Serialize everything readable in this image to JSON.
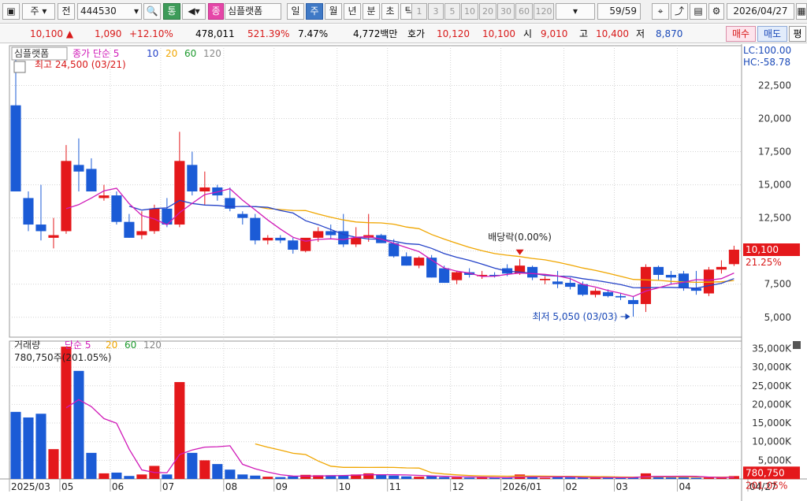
{
  "toolbar": {
    "mode_button": "주",
    "prev_label": "전",
    "stock_code": "444530",
    "tong_label": "통",
    "tag_label": "종",
    "stock_name": "심플랫폼",
    "periods": [
      "일",
      "주",
      "월",
      "년",
      "분",
      "초",
      "틱"
    ],
    "selected_period": "주",
    "intervals": [
      "1",
      "3",
      "5",
      "10",
      "20",
      "30",
      "60",
      "120"
    ],
    "count": "59/59",
    "date": "2026/04/27"
  },
  "quote": {
    "price": "10,100",
    "change": "1,090",
    "change_rate": "+12.10%",
    "volume": "478,011",
    "volume_rate": "521.39%",
    "turnover": "7.47%",
    "amount": "4,772백만",
    "hoga_label": "호가",
    "ask": "10,120",
    "bid": "10,100",
    "open_label": "시",
    "open": "9,010",
    "high_label": "고",
    "high": "10,400",
    "low_label": "저",
    "low": "8,870",
    "buy_label": "매수",
    "sell_label": "매도",
    "extra_label": "평"
  },
  "chart_data": {
    "type": "candlestick",
    "stock": "심플랫폼",
    "periods": [
      "2025/03",
      "05",
      "06",
      "07",
      "08",
      "09",
      "10",
      "11",
      "12",
      "2026/01",
      "02",
      "03",
      "04"
    ],
    "x_axis_labels": [
      "2025/03",
      "05",
      "06",
      "07",
      "08",
      "09",
      "10",
      "11",
      "12",
      "2026/01",
      "02",
      "03",
      "04",
      "04/27"
    ],
    "price_axis": {
      "ticks": [
        "22,500",
        "20,000",
        "17,500",
        "15,000",
        "12,500",
        "10,000",
        "7,500",
        "5,000"
      ],
      "ylim": [
        3500,
        25500
      ]
    },
    "volume_axis": {
      "ticks": [
        "35,000K",
        "30,000K",
        "25,000K",
        "20,000K",
        "15,000K",
        "10,000K",
        "5,000K"
      ],
      "ylim": [
        0,
        37000
      ]
    },
    "price_legend": {
      "name": "심플랫폼",
      "ma_label": "종가 단순",
      "ma_periods": [
        "5",
        "10",
        "20",
        "60",
        "120"
      ]
    },
    "volume_legend": {
      "name": "거래량",
      "ma_label": "단순",
      "ma_periods": [
        "5",
        "20",
        "60",
        "120"
      ],
      "current": "780,750주(201.05%)"
    },
    "annotations": {
      "high": "최고 24,500 (03/21)",
      "low": "최저 5,050 (03/03)",
      "dividend": "배당락(0.00%)",
      "lc": "LC:100.00",
      "hc": "HC:-58.78",
      "price_tag": "10,100",
      "rate_tag": "21.25%",
      "vol_tag": "780,750",
      "vol_rate_tag": "201.05%"
    },
    "colors": {
      "up": "#e4181b",
      "down": "#1b5bd6",
      "ma5": "#d01bb8",
      "ma10": "#2442c8",
      "ma20": "#f0a600",
      "ma60": "#1e9a2e",
      "ma120": "#888888"
    },
    "candles": [
      {
        "o": 21000,
        "h": 24500,
        "l": 14500,
        "c": 14500,
        "v": 18000
      },
      {
        "o": 14000,
        "h": 14500,
        "l": 11500,
        "c": 12000,
        "v": 16500
      },
      {
        "o": 12000,
        "h": 15000,
        "l": 10800,
        "c": 11500,
        "v": 17500
      },
      {
        "o": 11000,
        "h": 12500,
        "l": 10200,
        "c": 11200,
        "v": 8000
      },
      {
        "o": 11500,
        "h": 18000,
        "l": 11300,
        "c": 16800,
        "v": 35500
      },
      {
        "o": 16500,
        "h": 18500,
        "l": 14500,
        "c": 16000,
        "v": 29000
      },
      {
        "o": 16200,
        "h": 17000,
        "l": 14500,
        "c": 14500,
        "v": 7000
      },
      {
        "o": 14000,
        "h": 15000,
        "l": 13800,
        "c": 14200,
        "v": 1500
      },
      {
        "o": 14200,
        "h": 14500,
        "l": 12000,
        "c": 12200,
        "v": 1700
      },
      {
        "o": 12200,
        "h": 12800,
        "l": 11000,
        "c": 11000,
        "v": 800
      },
      {
        "o": 11200,
        "h": 13000,
        "l": 10900,
        "c": 11500,
        "v": 1200
      },
      {
        "o": 11500,
        "h": 13500,
        "l": 11300,
        "c": 13200,
        "v": 3500
      },
      {
        "o": 13200,
        "h": 14000,
        "l": 11800,
        "c": 12000,
        "v": 1200
      },
      {
        "o": 12000,
        "h": 19000,
        "l": 11800,
        "c": 16800,
        "v": 26000
      },
      {
        "o": 16500,
        "h": 17500,
        "l": 14200,
        "c": 14500,
        "v": 7000
      },
      {
        "o": 14500,
        "h": 16000,
        "l": 13500,
        "c": 14800,
        "v": 5000
      },
      {
        "o": 14800,
        "h": 15000,
        "l": 13800,
        "c": 14200,
        "v": 4000
      },
      {
        "o": 14000,
        "h": 14800,
        "l": 13000,
        "c": 13200,
        "v": 2500
      },
      {
        "o": 12800,
        "h": 13000,
        "l": 12000,
        "c": 12500,
        "v": 1200
      },
      {
        "o": 12500,
        "h": 12800,
        "l": 10500,
        "c": 10800,
        "v": 900
      },
      {
        "o": 10800,
        "h": 11200,
        "l": 10500,
        "c": 11000,
        "v": 600
      },
      {
        "o": 11000,
        "h": 11200,
        "l": 10600,
        "c": 10800,
        "v": 500
      },
      {
        "o": 10800,
        "h": 11000,
        "l": 9800,
        "c": 10100,
        "v": 700
      },
      {
        "o": 10000,
        "h": 10700,
        "l": 9900,
        "c": 11000,
        "v": 1100
      },
      {
        "o": 11000,
        "h": 11800,
        "l": 10700,
        "c": 11500,
        "v": 1000
      },
      {
        "o": 11500,
        "h": 12000,
        "l": 10900,
        "c": 11200,
        "v": 1000
      },
      {
        "o": 11500,
        "h": 12800,
        "l": 10300,
        "c": 10500,
        "v": 900
      },
      {
        "o": 10500,
        "h": 11800,
        "l": 10300,
        "c": 11000,
        "v": 1200
      },
      {
        "o": 11000,
        "h": 12800,
        "l": 10700,
        "c": 11200,
        "v": 1500
      },
      {
        "o": 11200,
        "h": 11300,
        "l": 10600,
        "c": 10600,
        "v": 1100
      },
      {
        "o": 10600,
        "h": 10900,
        "l": 9500,
        "c": 9600,
        "v": 900
      },
      {
        "o": 9600,
        "h": 9900,
        "l": 8900,
        "c": 8900,
        "v": 700
      },
      {
        "o": 8900,
        "h": 9600,
        "l": 8700,
        "c": 9500,
        "v": 600
      },
      {
        "o": 9500,
        "h": 9700,
        "l": 8000,
        "c": 8000,
        "v": 800
      },
      {
        "o": 8700,
        "h": 8900,
        "l": 7600,
        "c": 7600,
        "v": 500
      },
      {
        "o": 7800,
        "h": 8500,
        "l": 7500,
        "c": 8400,
        "v": 450
      },
      {
        "o": 8400,
        "h": 8700,
        "l": 8000,
        "c": 8200,
        "v": 350
      },
      {
        "o": 8100,
        "h": 8500,
        "l": 7900,
        "c": 8200,
        "v": 380
      },
      {
        "o": 8200,
        "h": 8400,
        "l": 8000,
        "c": 8100,
        "v": 300
      },
      {
        "o": 8700,
        "h": 9000,
        "l": 8100,
        "c": 8300,
        "v": 350
      },
      {
        "o": 8300,
        "h": 9400,
        "l": 8200,
        "c": 8900,
        "v": 1200
      },
      {
        "o": 8800,
        "h": 8900,
        "l": 7800,
        "c": 8000,
        "v": 500
      },
      {
        "o": 7800,
        "h": 8100,
        "l": 7500,
        "c": 7900,
        "v": 300
      },
      {
        "o": 7700,
        "h": 8500,
        "l": 7200,
        "c": 7500,
        "v": 500
      },
      {
        "o": 7600,
        "h": 8000,
        "l": 7100,
        "c": 7300,
        "v": 400
      },
      {
        "o": 7500,
        "h": 7700,
        "l": 6600,
        "c": 6700,
        "v": 400
      },
      {
        "o": 6700,
        "h": 7200,
        "l": 6500,
        "c": 7000,
        "v": 400
      },
      {
        "o": 6900,
        "h": 7100,
        "l": 6500,
        "c": 6600,
        "v": 350
      },
      {
        "o": 6600,
        "h": 6800,
        "l": 6300,
        "c": 6500,
        "v": 300
      },
      {
        "o": 6300,
        "h": 6600,
        "l": 5050,
        "c": 6000,
        "v": 500
      },
      {
        "o": 6000,
        "h": 9000,
        "l": 5400,
        "c": 8800,
        "v": 1500
      },
      {
        "o": 8800,
        "h": 8900,
        "l": 7800,
        "c": 8200,
        "v": 800
      },
      {
        "o": 8200,
        "h": 8500,
        "l": 7500,
        "c": 8000,
        "v": 400
      },
      {
        "o": 8300,
        "h": 8500,
        "l": 7000,
        "c": 7200,
        "v": 500
      },
      {
        "o": 7200,
        "h": 8500,
        "l": 6700,
        "c": 7000,
        "v": 300
      },
      {
        "o": 6800,
        "h": 8800,
        "l": 6600,
        "c": 8600,
        "v": 400
      },
      {
        "o": 8600,
        "h": 9300,
        "l": 8300,
        "c": 8800,
        "v": 300
      },
      {
        "o": 9010,
        "h": 10400,
        "l": 8870,
        "c": 10100,
        "v": 780.75
      }
    ]
  }
}
